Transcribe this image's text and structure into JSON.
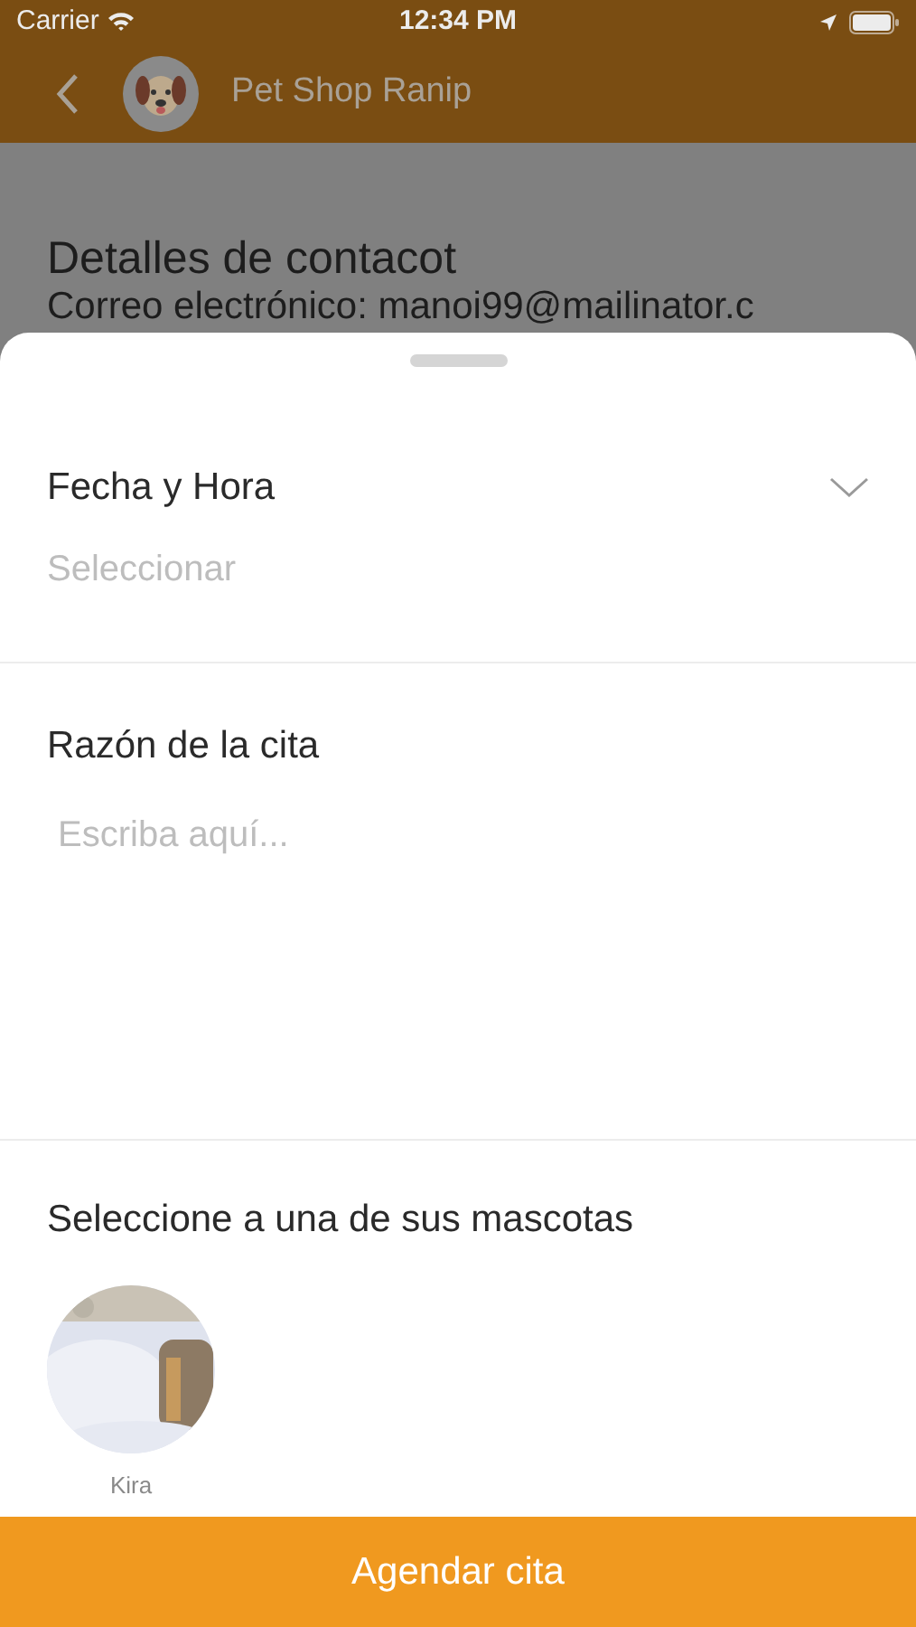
{
  "status_bar": {
    "carrier": "Carrier",
    "time": "12:34 PM"
  },
  "nav_bar": {
    "title": "Pet Shop Ranip"
  },
  "background": {
    "heading": "Detalles de contacot",
    "email_line": "Correo electrónico: manoi99@mailinator.c"
  },
  "sheet": {
    "date_field": {
      "label": "Fecha y Hora",
      "placeholder": "Seleccionar"
    },
    "reason_field": {
      "label": "Razón de la cita",
      "placeholder": "Escriba aquí..."
    },
    "pets": {
      "heading": "Seleccione a una de sus mascotas",
      "items": [
        {
          "name": "Kira",
          "kind": "picture"
        }
      ]
    },
    "submit": "Agendar cita"
  }
}
